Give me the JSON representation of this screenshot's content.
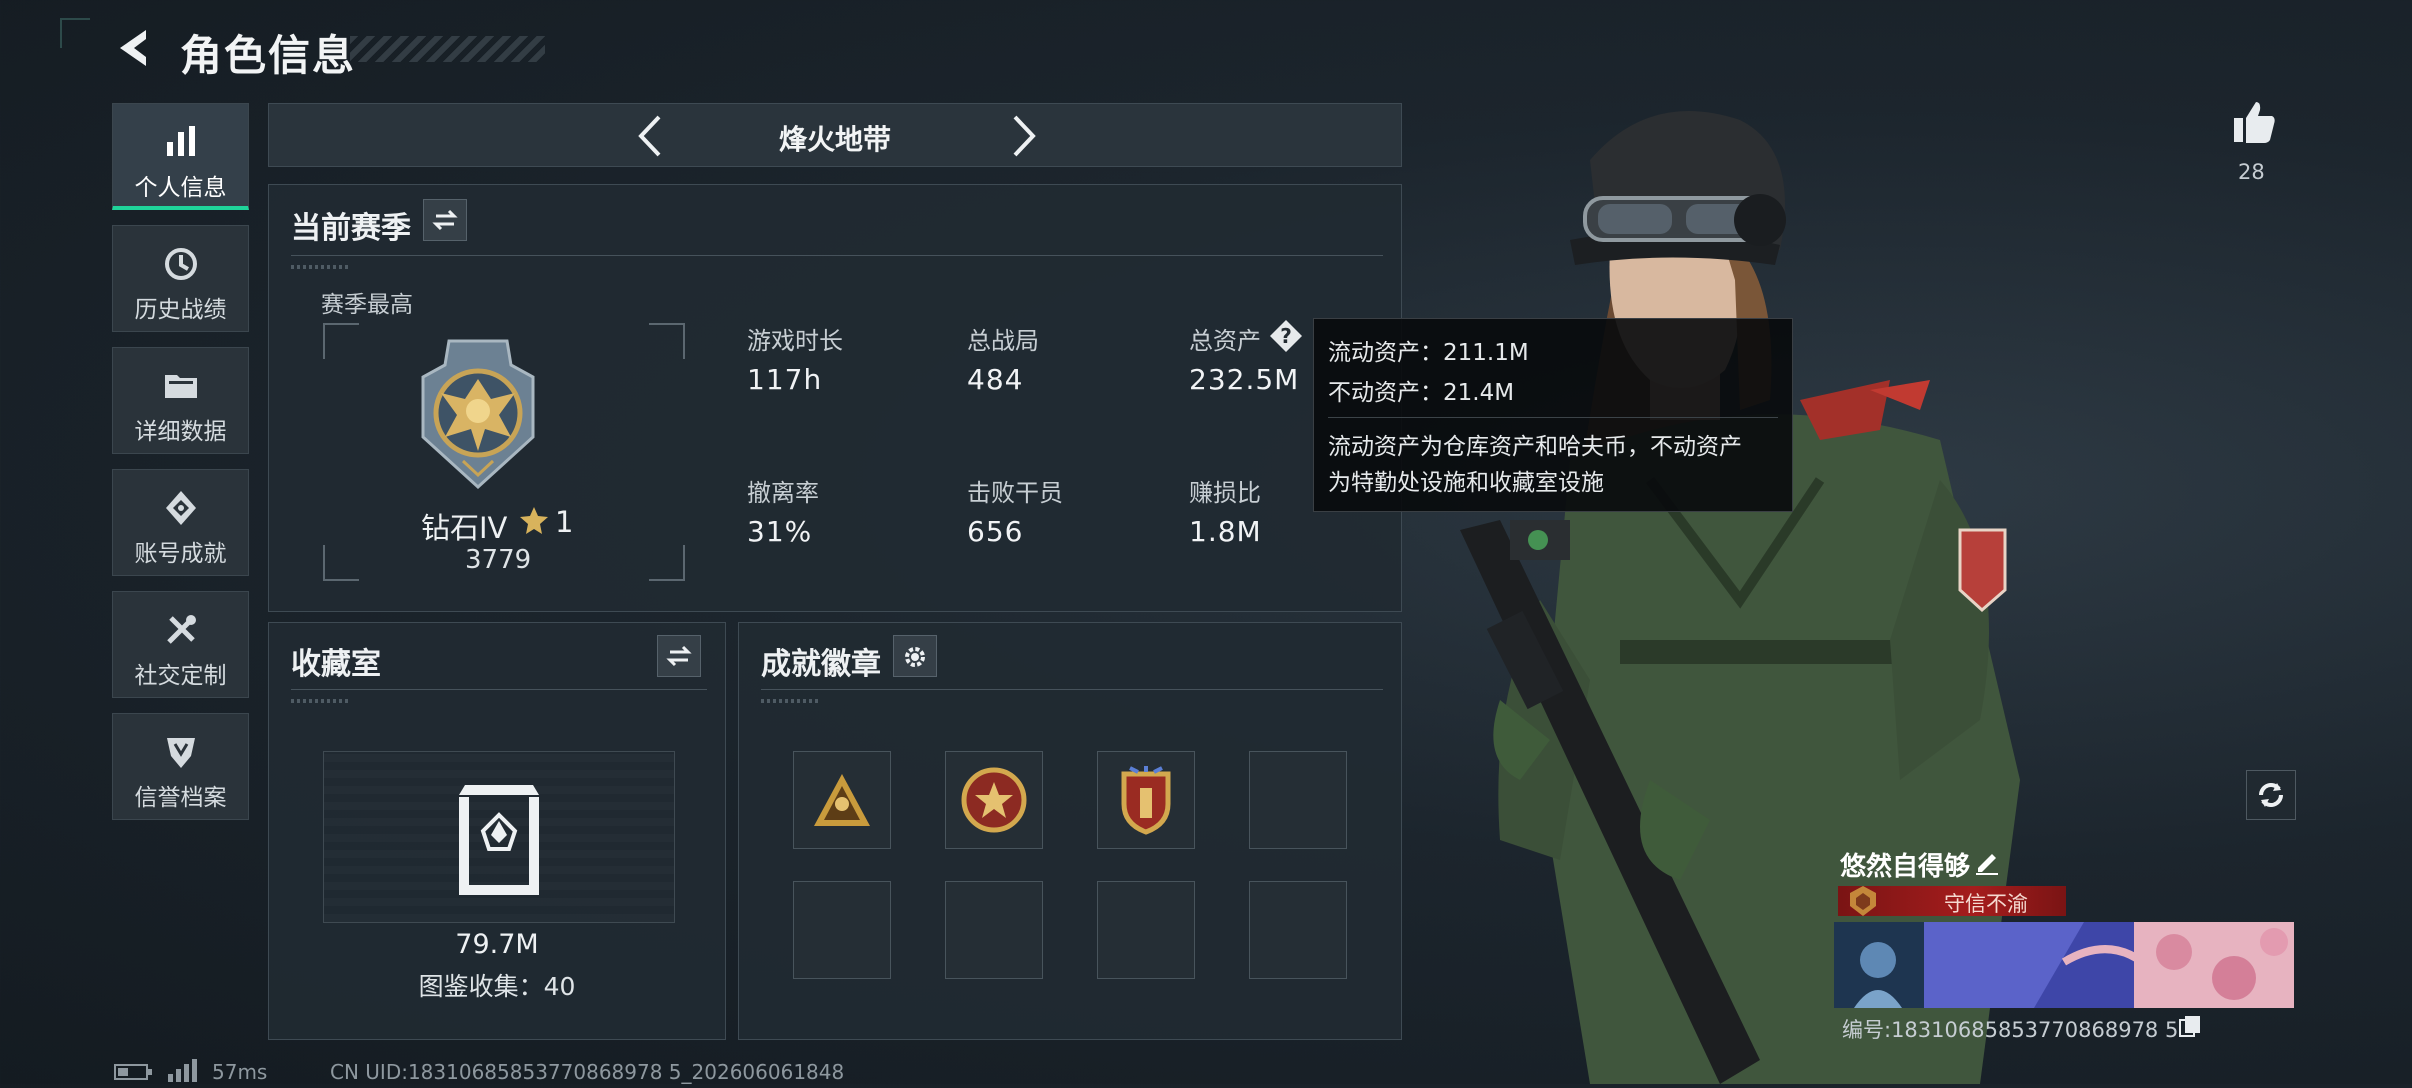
{
  "header": {
    "title": "角色信息"
  },
  "sidebar": {
    "items": [
      {
        "label": "个人信息",
        "icon": "bar-chart-icon",
        "active": true
      },
      {
        "label": "历史战绩",
        "icon": "history-icon",
        "active": false
      },
      {
        "label": "详细数据",
        "icon": "folder-icon",
        "active": false
      },
      {
        "label": "账号成就",
        "icon": "achievement-icon",
        "active": false
      },
      {
        "label": "社交定制",
        "icon": "tools-icon",
        "active": false
      },
      {
        "label": "信誉档案",
        "icon": "shield-icon",
        "active": false
      }
    ]
  },
  "mode_selector": {
    "current": "烽火地带"
  },
  "season": {
    "title": "当前赛季",
    "best_label": "赛季最高",
    "rank_name": "钻石IV",
    "rank_stars": "1",
    "rank_score": "3779",
    "stats": [
      {
        "label": "游戏时长",
        "value": "117h"
      },
      {
        "label": "总战局",
        "value": "484"
      },
      {
        "label": "总资产",
        "value": "232.5M"
      },
      {
        "label": "撤离率",
        "value": "31%"
      },
      {
        "label": "击败干员",
        "value": "656"
      },
      {
        "label": "赚损比",
        "value": "1.8M"
      }
    ]
  },
  "tooltip": {
    "liquid": "流动资产：211.1M",
    "fixed": "不动资产：21.4M",
    "desc_line1": "流动资产为仓库资产和哈夫币，不动资产",
    "desc_line2": "为特勤处设施和收藏室设施"
  },
  "collection": {
    "title": "收藏室",
    "value": "79.7M",
    "catalog": "图鉴收集：40"
  },
  "badges": {
    "title": "成就徽章"
  },
  "profile": {
    "likes": "28",
    "player_name": "悠然自得够",
    "honor_title": "守信不渝",
    "uid_line": "编号:18310685853770868978 5"
  },
  "footer": {
    "ping": "57ms",
    "uid": "CN UID:18310685853770868978 5_202606061848"
  },
  "colors": {
    "accent": "#1fd49a",
    "honor": "#a51d1d"
  }
}
